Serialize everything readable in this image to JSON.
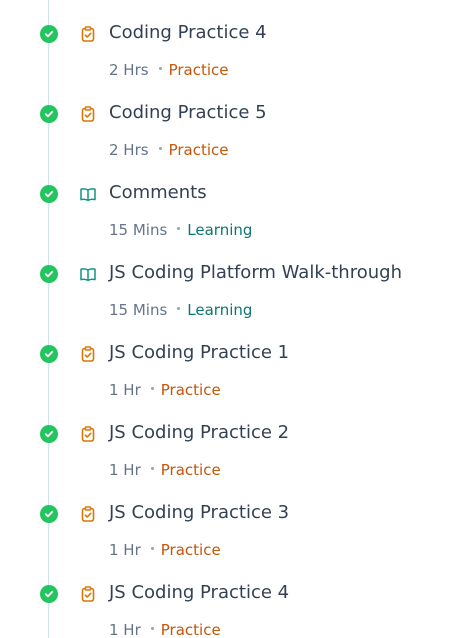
{
  "items": [
    {
      "title": "Coding Practice 4",
      "duration": "2 Hrs",
      "category": "Practice",
      "kind": "practice",
      "icon": "clipboard-check-icon",
      "completed": true
    },
    {
      "title": "Coding Practice 5",
      "duration": "2 Hrs",
      "category": "Practice",
      "kind": "practice",
      "icon": "clipboard-check-icon",
      "completed": true
    },
    {
      "title": "Comments",
      "duration": "15 Mins",
      "category": "Learning",
      "kind": "learning",
      "icon": "open-book-icon",
      "completed": true
    },
    {
      "title": "JS Coding Platform Walk-through",
      "duration": "15 Mins",
      "category": "Learning",
      "kind": "learning",
      "icon": "open-book-icon",
      "completed": true
    },
    {
      "title": "JS Coding Practice 1",
      "duration": "1 Hr",
      "category": "Practice",
      "kind": "practice",
      "icon": "clipboard-check-icon",
      "completed": true
    },
    {
      "title": "JS Coding Practice 2",
      "duration": "1 Hr",
      "category": "Practice",
      "kind": "practice",
      "icon": "clipboard-check-icon",
      "completed": true
    },
    {
      "title": "JS Coding Practice 3",
      "duration": "1 Hr",
      "category": "Practice",
      "kind": "practice",
      "icon": "clipboard-check-icon",
      "completed": true
    },
    {
      "title": "JS Coding Practice 4",
      "duration": "1 Hr",
      "category": "Practice",
      "kind": "practice",
      "icon": "clipboard-check-icon",
      "completed": true
    }
  ],
  "colors": {
    "completed_check": "#22c55e",
    "practice_accent": "#c2570c",
    "practice_icon": "#d97706",
    "learning_accent": "#0f766e",
    "learning_icon": "#0d9488",
    "timeline_rail": "#cfe0f1"
  }
}
